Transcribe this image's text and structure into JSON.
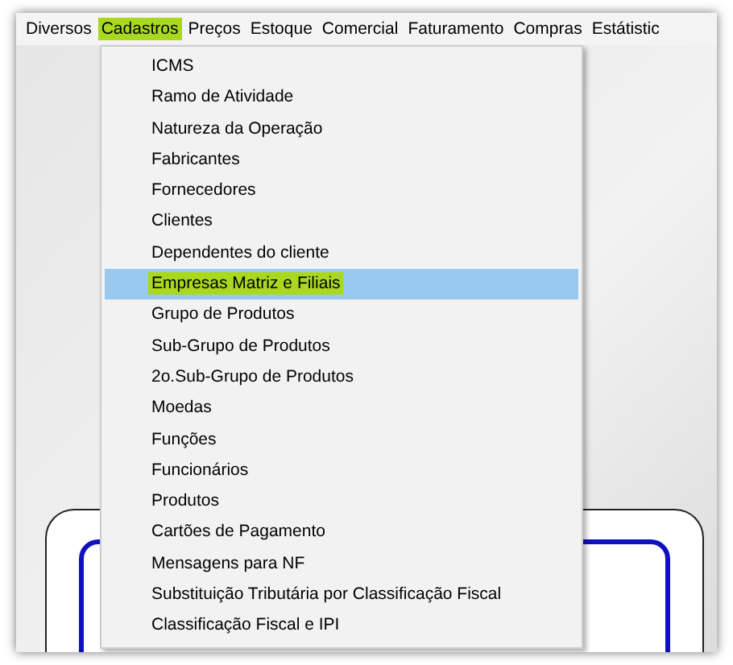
{
  "menu_bar": [
    {
      "label": "Diversos",
      "selected": false
    },
    {
      "label": "Cadastros",
      "selected": true
    },
    {
      "label": "Preços",
      "selected": false
    },
    {
      "label": "Estoque",
      "selected": false
    },
    {
      "label": "Comercial",
      "selected": false
    },
    {
      "label": "Faturamento",
      "selected": false
    },
    {
      "label": "Compras",
      "selected": false
    },
    {
      "label": "Estátistic",
      "selected": false
    }
  ],
  "dropdown_menu": [
    {
      "label": "ICMS",
      "selected": false
    },
    {
      "label": "Ramo de Atividade",
      "selected": false
    },
    {
      "label": "Natureza da Operação",
      "selected": false
    },
    {
      "label": "Fabricantes",
      "selected": false
    },
    {
      "label": "Fornecedores",
      "selected": false
    },
    {
      "label": "Clientes",
      "selected": false
    },
    {
      "label": "Dependentes do cliente",
      "selected": false
    },
    {
      "label": "Empresas Matriz e Filiais",
      "selected": true
    },
    {
      "label": "Grupo de Produtos",
      "selected": false
    },
    {
      "label": "Sub-Grupo de Produtos",
      "selected": false
    },
    {
      "label": "2o.Sub-Grupo de Produtos",
      "selected": false
    },
    {
      "label": "Moedas",
      "selected": false
    },
    {
      "label": "Funções",
      "selected": false
    },
    {
      "label": "Funcionários",
      "selected": false
    },
    {
      "label": "Produtos",
      "selected": false
    },
    {
      "label": "Cartões de Pagamento",
      "selected": false
    },
    {
      "label": "Mensagens para NF",
      "selected": false
    },
    {
      "label": "Substituição Tributária por Classificação Fiscal",
      "selected": false
    },
    {
      "label": "Classificação Fiscal e IPI",
      "selected": false
    }
  ]
}
